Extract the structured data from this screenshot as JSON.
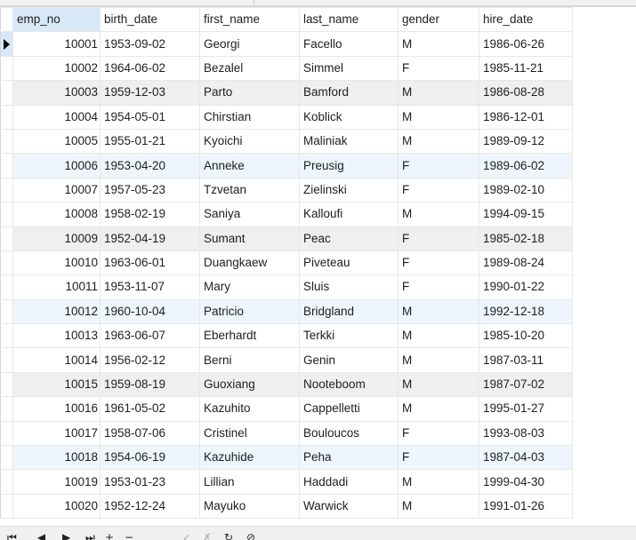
{
  "grid": {
    "columns": [
      "emp_no",
      "birth_date",
      "first_name",
      "last_name",
      "gender",
      "hire_date"
    ],
    "selected_column": "emp_no",
    "current_row_index": 0,
    "rows": [
      {
        "emp_no": "10001",
        "birth_date": "1953-09-02",
        "first_name": "Georgi",
        "last_name": "Facello",
        "gender": "M",
        "hire_date": "1986-06-26",
        "shade": "none"
      },
      {
        "emp_no": "10002",
        "birth_date": "1964-06-02",
        "first_name": "Bezalel",
        "last_name": "Simmel",
        "gender": "F",
        "hire_date": "1985-11-21",
        "shade": "none"
      },
      {
        "emp_no": "10003",
        "birth_date": "1959-12-03",
        "first_name": "Parto",
        "last_name": "Bamford",
        "gender": "M",
        "hire_date": "1986-08-28",
        "shade": "gray"
      },
      {
        "emp_no": "10004",
        "birth_date": "1954-05-01",
        "first_name": "Chirstian",
        "last_name": "Koblick",
        "gender": "M",
        "hire_date": "1986-12-01",
        "shade": "none"
      },
      {
        "emp_no": "10005",
        "birth_date": "1955-01-21",
        "first_name": "Kyoichi",
        "last_name": "Maliniak",
        "gender": "M",
        "hire_date": "1989-09-12",
        "shade": "none"
      },
      {
        "emp_no": "10006",
        "birth_date": "1953-04-20",
        "first_name": "Anneke",
        "last_name": "Preusig",
        "gender": "F",
        "hire_date": "1989-06-02",
        "shade": "blue"
      },
      {
        "emp_no": "10007",
        "birth_date": "1957-05-23",
        "first_name": "Tzvetan",
        "last_name": "Zielinski",
        "gender": "F",
        "hire_date": "1989-02-10",
        "shade": "none"
      },
      {
        "emp_no": "10008",
        "birth_date": "1958-02-19",
        "first_name": "Saniya",
        "last_name": "Kalloufi",
        "gender": "M",
        "hire_date": "1994-09-15",
        "shade": "none"
      },
      {
        "emp_no": "10009",
        "birth_date": "1952-04-19",
        "first_name": "Sumant",
        "last_name": "Peac",
        "gender": "F",
        "hire_date": "1985-02-18",
        "shade": "gray"
      },
      {
        "emp_no": "10010",
        "birth_date": "1963-06-01",
        "first_name": "Duangkaew",
        "last_name": "Piveteau",
        "gender": "F",
        "hire_date": "1989-08-24",
        "shade": "none"
      },
      {
        "emp_no": "10011",
        "birth_date": "1953-11-07",
        "first_name": "Mary",
        "last_name": "Sluis",
        "gender": "F",
        "hire_date": "1990-01-22",
        "shade": "none"
      },
      {
        "emp_no": "10012",
        "birth_date": "1960-10-04",
        "first_name": "Patricio",
        "last_name": "Bridgland",
        "gender": "M",
        "hire_date": "1992-12-18",
        "shade": "blue"
      },
      {
        "emp_no": "10013",
        "birth_date": "1963-06-07",
        "first_name": "Eberhardt",
        "last_name": "Terkki",
        "gender": "M",
        "hire_date": "1985-10-20",
        "shade": "none"
      },
      {
        "emp_no": "10014",
        "birth_date": "1956-02-12",
        "first_name": "Berni",
        "last_name": "Genin",
        "gender": "M",
        "hire_date": "1987-03-11",
        "shade": "none"
      },
      {
        "emp_no": "10015",
        "birth_date": "1959-08-19",
        "first_name": "Guoxiang",
        "last_name": "Nooteboom",
        "gender": "M",
        "hire_date": "1987-07-02",
        "shade": "gray"
      },
      {
        "emp_no": "10016",
        "birth_date": "1961-05-02",
        "first_name": "Kazuhito",
        "last_name": "Cappelletti",
        "gender": "M",
        "hire_date": "1995-01-27",
        "shade": "none"
      },
      {
        "emp_no": "10017",
        "birth_date": "1958-07-06",
        "first_name": "Cristinel",
        "last_name": "Bouloucos",
        "gender": "F",
        "hire_date": "1993-08-03",
        "shade": "none"
      },
      {
        "emp_no": "10018",
        "birth_date": "1954-06-19",
        "first_name": "Kazuhide",
        "last_name": "Peha",
        "gender": "F",
        "hire_date": "1987-04-03",
        "shade": "blue"
      },
      {
        "emp_no": "10019",
        "birth_date": "1953-01-23",
        "first_name": "Lillian",
        "last_name": "Haddadi",
        "gender": "M",
        "hire_date": "1999-04-30",
        "shade": "none"
      },
      {
        "emp_no": "10020",
        "birth_date": "1952-12-24",
        "first_name": "Mayuko",
        "last_name": "Warwick",
        "gender": "M",
        "hire_date": "1991-01-26",
        "shade": "none"
      }
    ]
  },
  "toolbar": {
    "buttons": [
      {
        "name": "first-record-button",
        "icon": "first-icon",
        "glyph": "⏮",
        "enabled": true
      },
      {
        "name": "prev-record-button",
        "icon": "prev-icon",
        "glyph": "◀",
        "enabled": true
      },
      {
        "name": "next-record-button",
        "icon": "next-icon",
        "glyph": "▶",
        "enabled": true
      },
      {
        "name": "last-record-button",
        "icon": "last-icon",
        "glyph": "⏭",
        "enabled": true
      },
      {
        "name": "insert-record-button",
        "icon": "plus-icon",
        "glyph": "+",
        "enabled": true
      },
      {
        "name": "delete-record-button",
        "icon": "minus-icon",
        "glyph": "−",
        "enabled": true
      },
      {
        "name": "apply-changes-button",
        "icon": "check-icon",
        "glyph": "✓",
        "enabled": false
      },
      {
        "name": "discard-changes-button",
        "icon": "cross-icon",
        "glyph": "✗",
        "enabled": false
      },
      {
        "name": "refresh-button",
        "icon": "refresh-icon",
        "glyph": "↻",
        "enabled": true
      },
      {
        "name": "stop-button",
        "icon": "stop-icon",
        "glyph": "⊘",
        "enabled": true
      }
    ]
  }
}
